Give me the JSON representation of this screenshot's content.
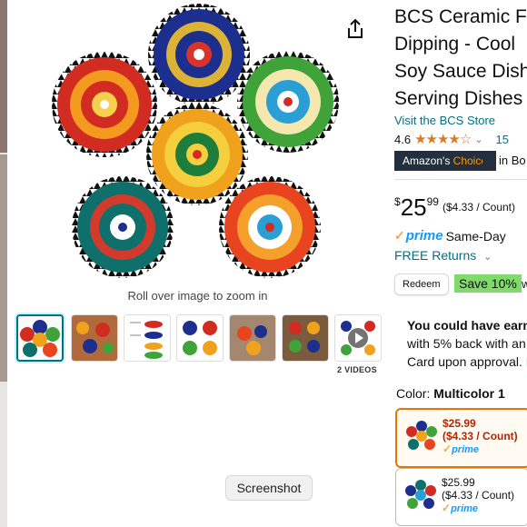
{
  "product": {
    "title_lines": [
      "BCS Ceramic F",
      "Dipping - Cool",
      "Soy Sauce Dish",
      "Serving Dishes"
    ],
    "store_link": "Visit the BCS Store",
    "rating": "4.6",
    "stars": "★★★★☆",
    "review_count": "15",
    "choice_badge_a": "Amazon's",
    "choice_badge_b": " Choice",
    "choice_category": "in Bo"
  },
  "price": {
    "currency": "$",
    "whole": "25",
    "fraction": "99",
    "unit": "($4.33 / Count)"
  },
  "delivery": {
    "prime": "prime",
    "same_day": "Same-Day",
    "returns": "FREE Returns"
  },
  "coupon": {
    "redeem": "Redeem",
    "save": "Save 10%",
    "save_tail": "w"
  },
  "credit": {
    "line1": "You could have earne",
    "line2": "with 5% back with an",
    "line3": "Card upon approval.",
    "line3_link": "L"
  },
  "color": {
    "label": "Color:",
    "value": "Multicolor 1"
  },
  "swatches": [
    {
      "price": "$25.99",
      "unit": "($4.33 / Count)",
      "prime": "prime"
    },
    {
      "price": "$25.99",
      "unit": "($4.33 / Count)",
      "prime": "prime"
    }
  ],
  "gallery": {
    "zoom_hint": "Roll over image to zoom in",
    "videos_label": "2 VIDEOS"
  },
  "tooltip": "Screenshot",
  "colors": {
    "link": "#007185",
    "price_red": "#b12704",
    "prime_blue": "#1399ff",
    "save_green": "#7fda69",
    "badge_navy": "#232f3e",
    "selected_orange": "#e77600"
  }
}
